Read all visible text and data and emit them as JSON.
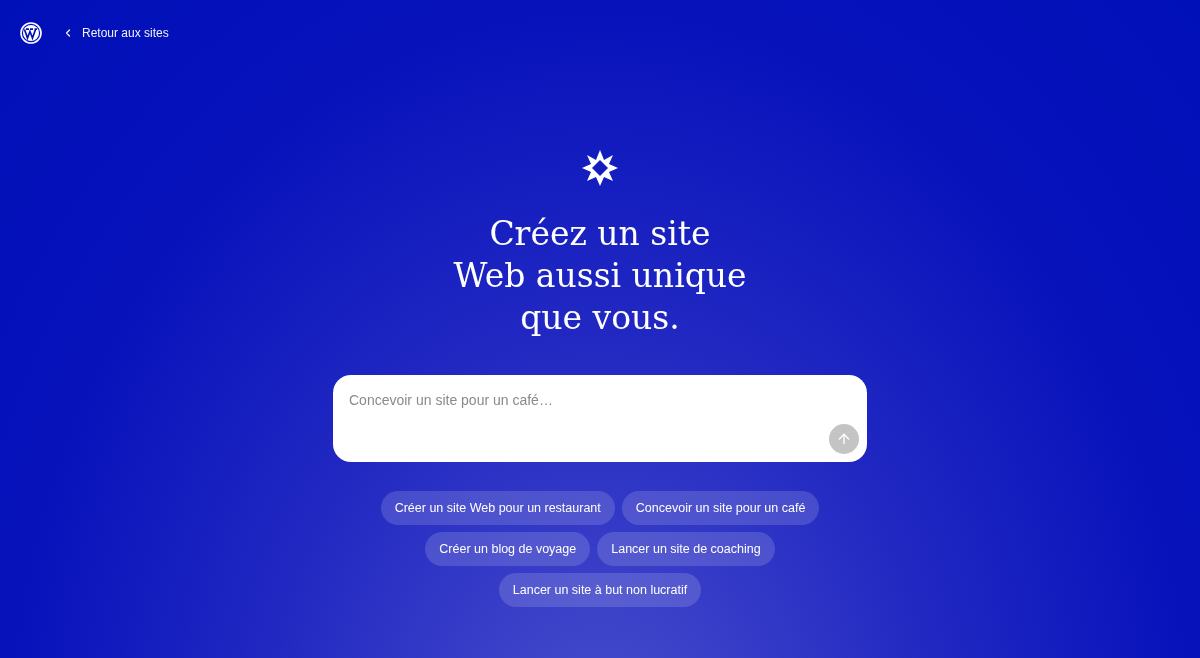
{
  "header": {
    "back_link": "Retour aux sites"
  },
  "headline_lines": [
    "Créez un site",
    "Web aussi unique",
    "que vous."
  ],
  "prompt": {
    "placeholder": "Concevoir un site pour un café…",
    "send_disabled": true
  },
  "suggestion_rows": [
    [
      "Créer un site Web pour un restaurant",
      "Concevoir un site pour un café"
    ],
    [
      "Créer un blog de voyage",
      "Lancer un site de coaching"
    ],
    [
      "Lancer un site à but non lucratif"
    ]
  ]
}
